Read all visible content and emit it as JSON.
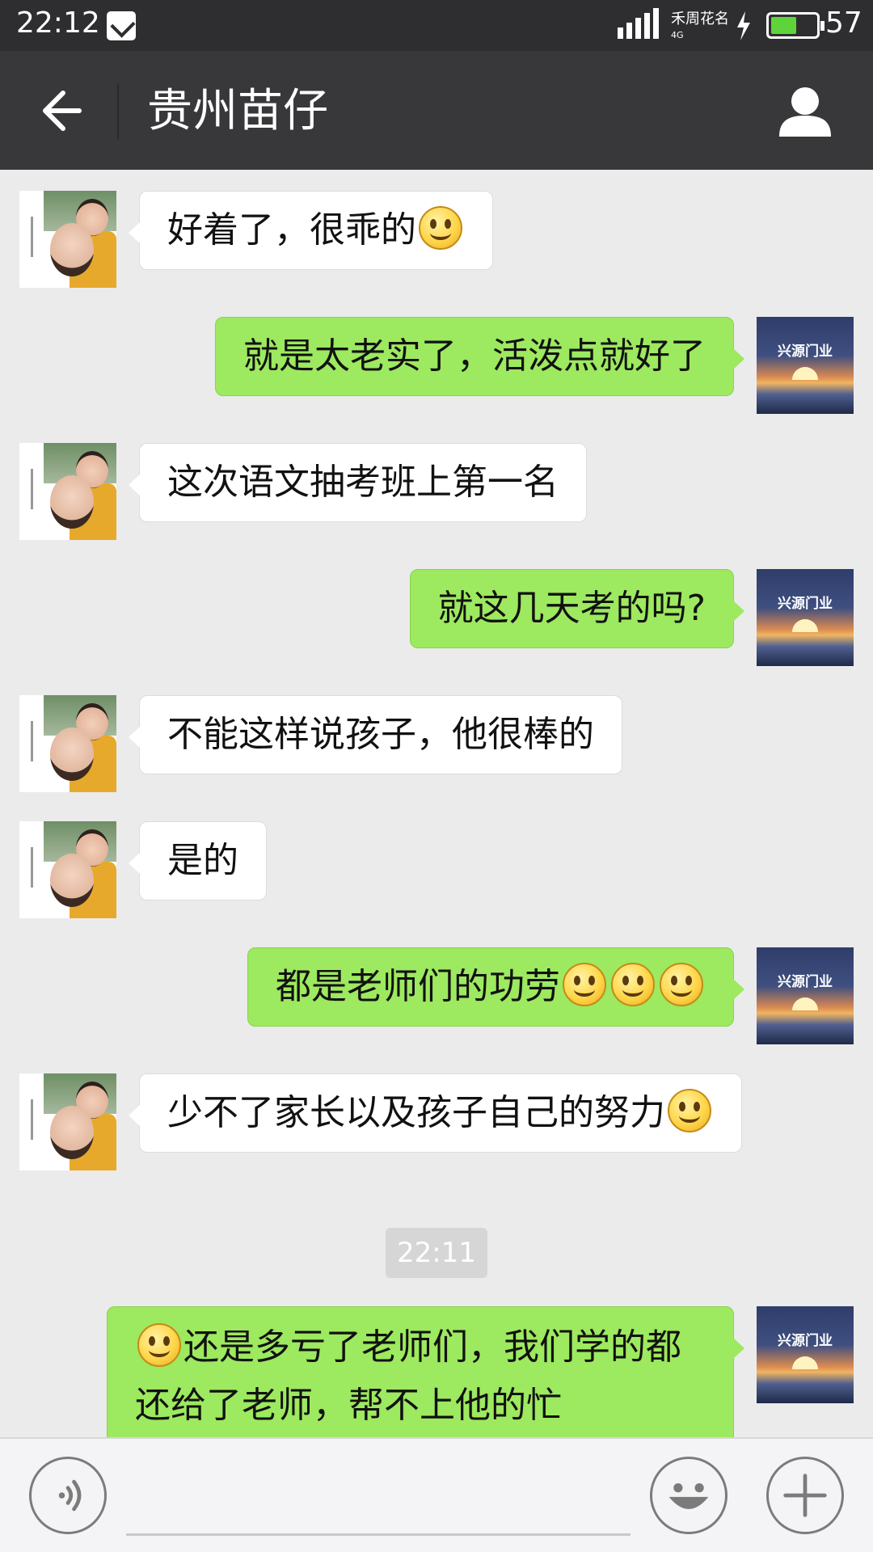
{
  "status_bar": {
    "time": "22:12",
    "carrier": "禾周花名",
    "network": "4G",
    "battery_percent": "57",
    "battery_level": 0.57
  },
  "header": {
    "title": "贵州苗仔",
    "avatar_brand": "兴源门业"
  },
  "messages": [
    {
      "side": "left",
      "text": "好着了，很乖的",
      "emoji_count": 1
    },
    {
      "side": "right",
      "text": "就是太老实了，活泼点就好了",
      "emoji_count": 0
    },
    {
      "side": "left",
      "text": "这次语文抽考班上第一名",
      "emoji_count": 0
    },
    {
      "side": "right",
      "text": "就这几天考的吗?",
      "emoji_count": 0
    },
    {
      "side": "left",
      "text": "不能这样说孩子，他很棒的",
      "emoji_count": 0
    },
    {
      "side": "left",
      "text": "是的",
      "emoji_count": 0
    },
    {
      "side": "right",
      "text": "都是老师们的功劳",
      "emoji_count": 3
    },
    {
      "side": "left",
      "text": "少不了家长以及孩子自己的努力",
      "emoji_count": 1
    },
    {
      "side": "right",
      "text": "还是多亏了老师们，我们学的都还给了老师，帮不上他的忙",
      "emoji_count": 1,
      "emoji_first": true
    }
  ],
  "time_divider": "22:11",
  "colors": {
    "status_bar": "#2e2e30",
    "title_bar": "#38383b",
    "chat_bg": "#ebebeb",
    "bubble_sent": "#9de95f",
    "bubble_received": "#ffffff",
    "battery": "#5fd43a"
  },
  "icons": {
    "back": "arrow-left-icon",
    "profile": "person-icon",
    "voice": "voice-icon",
    "emoji": "smiley-face-icon",
    "plus": "plus-icon"
  }
}
